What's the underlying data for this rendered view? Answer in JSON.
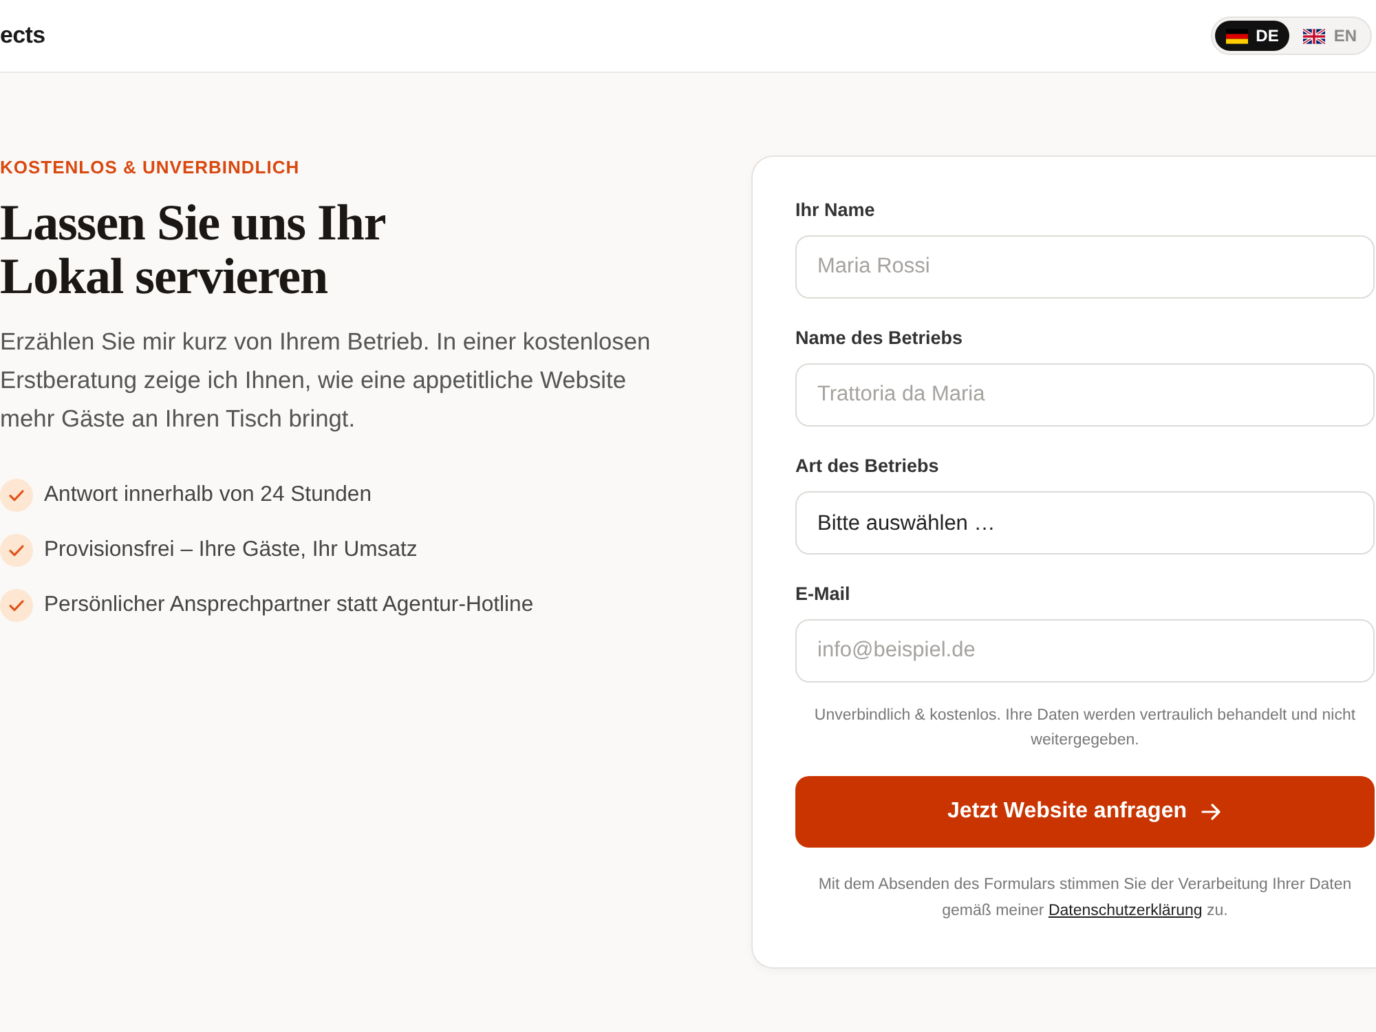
{
  "header": {
    "logo": "ects",
    "languages": [
      {
        "code": "DE",
        "kind": "german",
        "selected": true
      },
      {
        "code": "EN",
        "kind": "british",
        "selected": false
      }
    ]
  },
  "hero": {
    "eyebrow": "KOSTENLOS & UNVERBINDLICH",
    "title": "Lassen Sie uns Ihr Lokal servieren",
    "intro": "Erzählen Sie mir kurz von Ihrem Betrieb. In einer kostenlosen Erstberatung zeige ich Ihnen, wie eine appetitliche Website mehr Gäste an Ihren Tisch bringt.",
    "benefits": [
      "Antwort innerhalb von 24 Stunden",
      "Provisionsfrei – Ihre Gäste, Ihr Umsatz",
      "Persönlicher Ansprechpartner statt Agentur-Hotline"
    ]
  },
  "form": {
    "fields": [
      {
        "kind": "text",
        "label": "Ihr Name",
        "placeholder": "Maria Rossi"
      },
      {
        "kind": "text",
        "label": "Name des Betriebs",
        "placeholder": "Trattoria da Maria"
      },
      {
        "kind": "select",
        "label": "Art des Betriebs",
        "value": "Bitte auswählen …"
      },
      {
        "kind": "text",
        "label": "E-Mail",
        "placeholder": "info@beispiel.de"
      }
    ],
    "note": "Unverbindlich & kostenlos. Ihre Daten werden vertraulich behandelt und nicht weitergegeben.",
    "submit": "Jetzt Website anfragen",
    "consent": {
      "before": "Mit dem Absenden des Formulars stimmen Sie der Verarbeitung Ihrer Daten gemäß meiner",
      "link": "Datenschutzerklärung",
      "after": "zu."
    }
  }
}
